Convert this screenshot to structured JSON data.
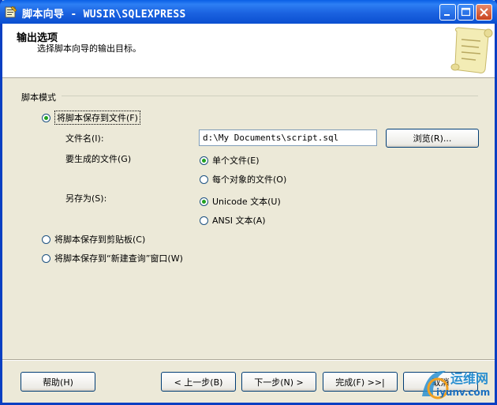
{
  "window": {
    "title": "脚本向导 - WUSIR\\SQLEXPRESS"
  },
  "header": {
    "title": "输出选项",
    "subtitle": "选择脚本向导的输出目标。"
  },
  "script_mode": {
    "group_label": "脚本模式",
    "option_file": {
      "label": "将脚本保存到文件(F)",
      "selected": true
    },
    "file_name_label": "文件名(I):",
    "file_name_value": "d:\\My Documents\\script.sql",
    "browse_label": "浏览(R)...",
    "generate_label": "要生成的文件(G)",
    "single_file": {
      "label": "单个文件(E)",
      "selected": true
    },
    "file_per_object": {
      "label": "每个对象的文件(O)",
      "selected": false
    },
    "save_as_label": "另存为(S):",
    "unicode_text": {
      "label": "Unicode 文本(U)",
      "selected": true
    },
    "ansi_text": {
      "label": "ANSI 文本(A)",
      "selected": false
    },
    "option_clipboard": {
      "label": "将脚本保存到剪贴板(C)",
      "selected": false
    },
    "option_new_query": {
      "label": "将脚本保存到“新建查询”窗口(W)",
      "selected": false
    }
  },
  "footer": {
    "help": "帮助(H)",
    "back": "< 上一步(B)",
    "next": "下一步(N) >",
    "finish": "完成(F) >>|",
    "cancel": "取消"
  },
  "watermark": {
    "line1": "运维网",
    "line2": "iyunv.com"
  },
  "colors": {
    "titlebar": "#0a5fe6",
    "dialog_bg": "#ece9d8",
    "radio_dot": "#21a121",
    "button_border": "#003c74"
  }
}
